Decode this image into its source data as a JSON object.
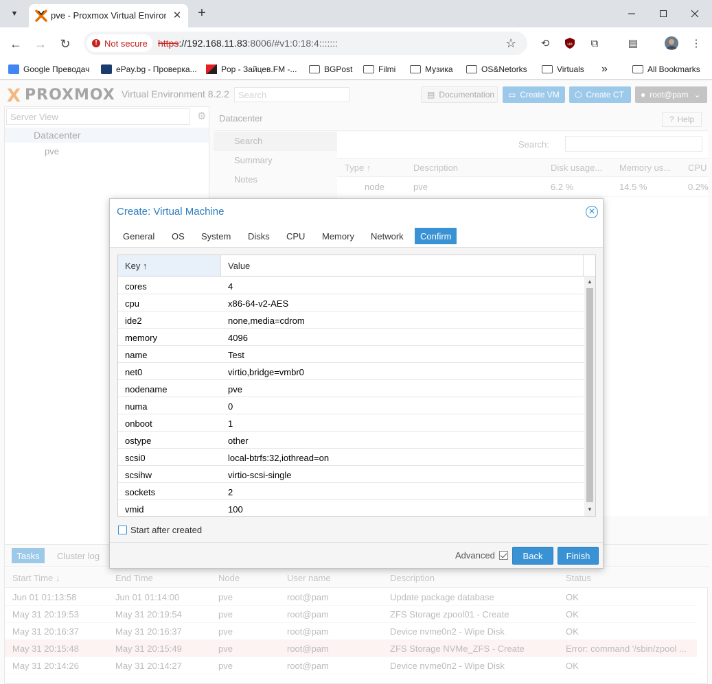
{
  "browser": {
    "tab_title": "pve - Proxmox Virtual Environme",
    "not_secure": "Not secure",
    "url_scheme": "https",
    "url_host": "://192.168.11.83",
    "url_rest": ":8006/#v1:0:18:4:::::::",
    "bookmarks": [
      "Google Преводач",
      "ePay.bg - Проверка...",
      "Pop - Зайцев.FM -...",
      "BGPost",
      "Filmi",
      "Музика",
      "OS&Netorks",
      "Virtuals"
    ],
    "bookmarks_more": "»",
    "all_bookmarks": "All Bookmarks"
  },
  "pve": {
    "logo_x": "X",
    "logo_text": "PROXMOX",
    "version": "Virtual Environment 8.2.2",
    "search_placeholder": "Search",
    "documentation": "Documentation",
    "create_vm": "Create VM",
    "create_ct": "Create CT",
    "user": "root@pam",
    "server_view": "Server View",
    "tree": [
      "Datacenter",
      "pve"
    ],
    "content_title": "Datacenter",
    "help": "Help",
    "menu": [
      "Search",
      "Summary",
      "Notes"
    ],
    "grid_search_label": "Search:",
    "grid_columns": [
      "Type ↑",
      "Description",
      "Disk usage...",
      "Memory us...",
      "CPU"
    ],
    "grid_row": [
      "node",
      "pve",
      "6.2 %",
      "14.5 %",
      "0.2%"
    ]
  },
  "tasks": {
    "tabs": [
      "Tasks",
      "Cluster log"
    ],
    "columns": [
      "Start Time ↓",
      "End Time",
      "Node",
      "User name",
      "Description",
      "Status"
    ],
    "rows": [
      {
        "start": "Jun 01 01:13:58",
        "end": "Jun 01 01:14:00",
        "node": "pve",
        "user": "root@pam",
        "desc": "Update package database",
        "status": "OK"
      },
      {
        "start": "May 31 20:19:53",
        "end": "May 31 20:19:54",
        "node": "pve",
        "user": "root@pam",
        "desc": "ZFS Storage zpool01 - Create",
        "status": "OK"
      },
      {
        "start": "May 31 20:16:37",
        "end": "May 31 20:16:37",
        "node": "pve",
        "user": "root@pam",
        "desc": "Device nvme0n2 - Wipe Disk",
        "status": "OK"
      },
      {
        "start": "May 31 20:15:48",
        "end": "May 31 20:15:49",
        "node": "pve",
        "user": "root@pam",
        "desc": "ZFS Storage NVMe_ZFS - Create",
        "status": "Error: command '/sbin/zpool ..."
      },
      {
        "start": "May 31 20:14:26",
        "end": "May 31 20:14:27",
        "node": "pve",
        "user": "root@pam",
        "desc": "Device nvme0n2 - Wipe Disk",
        "status": "OK"
      }
    ]
  },
  "modal": {
    "title": "Create: Virtual Machine",
    "tabs": [
      "General",
      "OS",
      "System",
      "Disks",
      "CPU",
      "Memory",
      "Network",
      "Confirm"
    ],
    "active_tab": "Confirm",
    "col_key": "Key ↑",
    "col_value": "Value",
    "rows": [
      {
        "key": "cores",
        "value": "4"
      },
      {
        "key": "cpu",
        "value": "x86-64-v2-AES"
      },
      {
        "key": "ide2",
        "value": "none,media=cdrom"
      },
      {
        "key": "memory",
        "value": "4096"
      },
      {
        "key": "name",
        "value": "Test"
      },
      {
        "key": "net0",
        "value": "virtio,bridge=vmbr0"
      },
      {
        "key": "nodename",
        "value": "pve"
      },
      {
        "key": "numa",
        "value": "0"
      },
      {
        "key": "onboot",
        "value": "1"
      },
      {
        "key": "ostype",
        "value": "other"
      },
      {
        "key": "scsi0",
        "value": "local-btrfs:32,iothread=on"
      },
      {
        "key": "scsihw",
        "value": "virtio-scsi-single"
      },
      {
        "key": "sockets",
        "value": "2"
      },
      {
        "key": "vmid",
        "value": "100"
      }
    ],
    "start_after_created": "Start after created",
    "advanced": "Advanced",
    "back": "Back",
    "finish": "Finish"
  },
  "colors": {
    "accent": "#3892d4",
    "proxmox_orange": "#e57000",
    "error_row": "#fbe7e7"
  }
}
